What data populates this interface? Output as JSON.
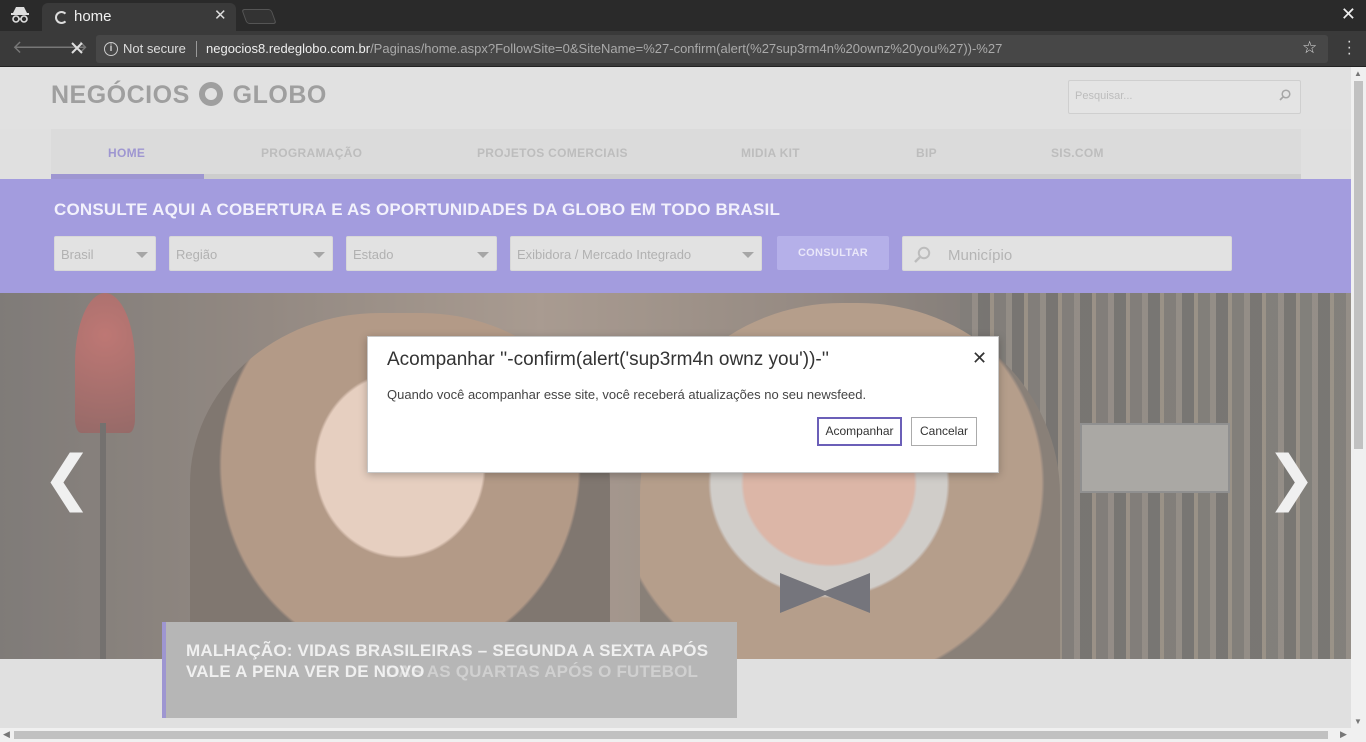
{
  "browser": {
    "tab_title": "home",
    "tab_close": "✕",
    "window_close": "✕",
    "security_label": "Not secure",
    "url_host": "negocios8.redeglobo.com.br",
    "url_path": "/Paginas/home.aspx?FollowSite=0&SiteName=%27-confirm(alert(%27sup3rm4n%20ownz%20you%27))-%27"
  },
  "header": {
    "logo_left": "NEGÓCIOS",
    "logo_right": "GLOBO",
    "search_placeholder": "Pesquisar..."
  },
  "nav": {
    "items": [
      "HOME",
      "PROGRAMAÇÃO",
      "PROJETOS COMERCIAIS",
      "MIDIA KIT",
      "BIP",
      "SIS.COM"
    ],
    "active": "HOME"
  },
  "coverage": {
    "heading": "CONSULTE AQUI A COBERTURA E AS OPORTUNIDADES DA GLOBO EM TODO BRASIL",
    "selects": [
      "Brasil",
      "Região",
      "Estado",
      "Exibidora / Mercado Integrado"
    ],
    "submit_label": "CONSULTAR",
    "municipio_placeholder": "Município"
  },
  "hero": {
    "caption_line1": "MALHAÇÃO: VIDAS BRASILEIRAS – SEGUNDA A SEXTA APÓS",
    "caption_line2a": "VALE A PENA VER DE NOVO",
    "caption_line2b": "DAS AS QUARTAS APÓS O FUTEBOL",
    "prev": "❮",
    "next": "❯"
  },
  "dialog": {
    "title": "Acompanhar ''-confirm(alert('sup3rm4n ownz you'))-''",
    "close": "✕",
    "message": "Quando você acompanhar esse site, você receberá atualizações no seu newsfeed.",
    "confirm_label": "Acompanhar",
    "cancel_label": "Cancelar"
  },
  "colors": {
    "accent": "#6b5fb8",
    "band": "#7268cc"
  }
}
